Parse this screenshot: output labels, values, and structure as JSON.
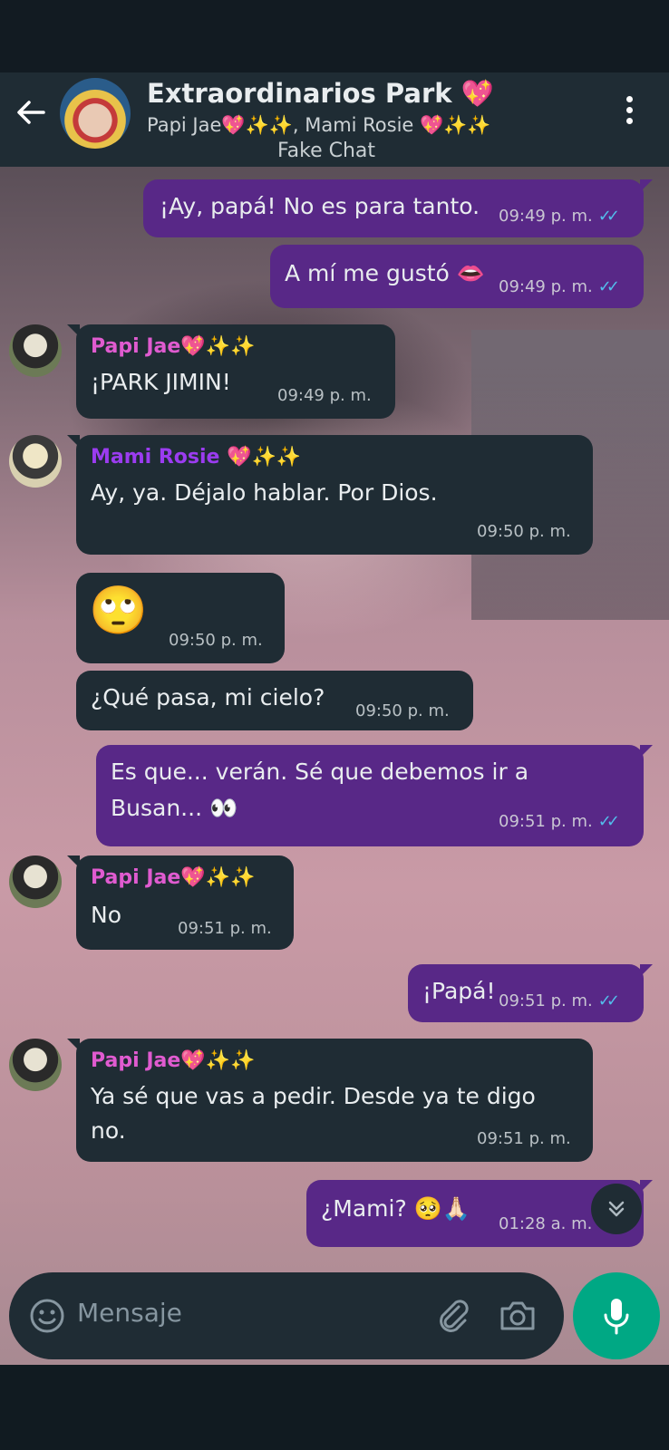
{
  "header": {
    "title": "Extraordinarios Park 💖",
    "subtitle": "Papi Jae💖✨✨, Mami Rosie 💖✨✨",
    "watermark": "Fake Chat"
  },
  "messages": [
    {
      "text": "¡Ay, papá! No es para tanto.",
      "time": "09:49 p. m."
    },
    {
      "text": "A mí me gustó 👄",
      "time": "09:49 p. m."
    },
    {
      "sender": "Papi Jae💖✨✨",
      "text": "¡PARK JIMIN!",
      "time": "09:49 p. m."
    },
    {
      "sender": "Mami Rosie 💖✨✨",
      "text": "Ay, ya. Déjalo hablar. Por Dios.",
      "time": "09:50 p. m."
    },
    {
      "text": "🙄",
      "time": "09:50 p. m."
    },
    {
      "text": "¿Qué pasa, mi cielo?",
      "time": "09:50 p. m."
    },
    {
      "text_line1": "Es que... verán. Sé que debemos ir a",
      "text_line2": "Busan... 👀",
      "time": "09:51 p. m."
    },
    {
      "sender": "Papi Jae💖✨✨",
      "text": "No",
      "time": "09:51 p. m."
    },
    {
      "text": "¡Papá!",
      "time": "09:51 p. m."
    },
    {
      "sender": "Papi Jae💖✨✨",
      "text_line1": "Ya sé que vas a pedir. Desde ya te digo",
      "text_line2": "no.",
      "time": "09:51 p. m."
    },
    {
      "text": "¿Mami? 🥺🙏🏻",
      "time": "01:28 a. m."
    }
  ],
  "input": {
    "placeholder": "Mensaje"
  },
  "colors": {
    "outgoing_bubble": "#582887",
    "incoming_bubble": "#1f2c34",
    "papi_name": "#e05bd0",
    "mami_name": "#9b3cf0",
    "read_ticks": "#53bdeb",
    "mic_button": "#00a884"
  },
  "icons": [
    "back-arrow-icon",
    "more-vert-icon",
    "double-check-icon",
    "chevron-double-down-icon",
    "emoji-icon",
    "attach-icon",
    "camera-icon",
    "mic-icon"
  ]
}
